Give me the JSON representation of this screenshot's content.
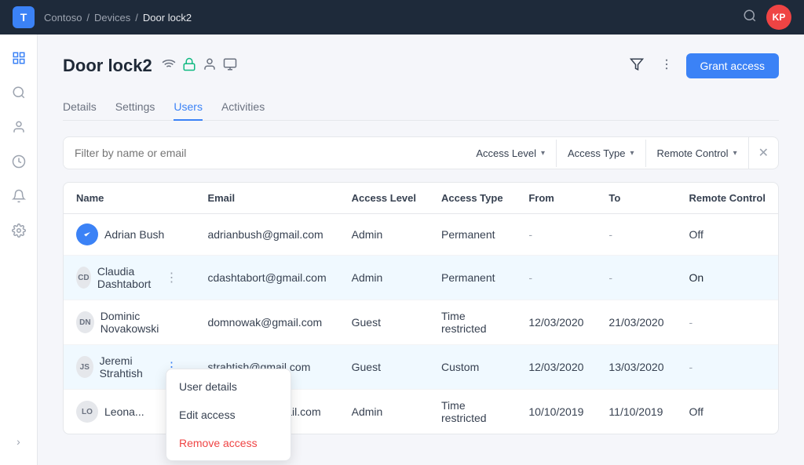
{
  "topbar": {
    "logo": "T",
    "breadcrumb": [
      "Contoso",
      "Devices",
      "Door lock2"
    ],
    "avatar": "KP"
  },
  "page": {
    "title": "Door lock2",
    "tabs": [
      "Details",
      "Settings",
      "Users",
      "Activities"
    ],
    "active_tab": "Users",
    "grant_button": "Grant access"
  },
  "filter": {
    "search_placeholder": "Filter by name or email",
    "dropdowns": [
      "Access Level",
      "Access Type",
      "Remote Control"
    ]
  },
  "table": {
    "columns": [
      "Name",
      "Email",
      "Access Level",
      "Access Type",
      "From",
      "To",
      "Remote Control"
    ],
    "rows": [
      {
        "id": 1,
        "name": "Adrian Bush",
        "email": "adrianbush@gmail.com",
        "access_level": "Admin",
        "access_type": "Permanent",
        "from": "-",
        "to": "-",
        "remote_control": "Off",
        "checked": true
      },
      {
        "id": 2,
        "name": "Claudia Dashtabort",
        "email": "cdashtabort@gmail.com",
        "access_level": "Admin",
        "access_type": "Permanent",
        "from": "-",
        "to": "-",
        "remote_control": "On",
        "highlighted": true
      },
      {
        "id": 3,
        "name": "Dominic Novakowski",
        "email": "domnowak@gmail.com",
        "access_level": "Guest",
        "access_type": "Time restricted",
        "from": "12/03/2020",
        "to": "21/03/2020",
        "remote_control": "-"
      },
      {
        "id": 4,
        "name": "Jeremi Strahtish",
        "email": "strahtish@gmail.com",
        "access_level": "Guest",
        "access_type": "Custom",
        "from": "12/03/2020",
        "to": "13/03/2020",
        "remote_control": "-",
        "menu_open": true
      },
      {
        "id": 5,
        "name": "Leona...",
        "email": "leonardo.o@gmail.com",
        "access_level": "Admin",
        "access_type": "Time restricted",
        "from": "10/10/2019",
        "to": "11/10/2019",
        "remote_control": "Off"
      }
    ]
  },
  "context_menu": {
    "items": [
      "User details",
      "Edit access",
      "Remove access"
    ],
    "danger_item": "Remove access"
  },
  "sidebar": {
    "icons": [
      "grid",
      "search",
      "person",
      "clock",
      "bell",
      "settings"
    ],
    "expand_label": "›"
  }
}
